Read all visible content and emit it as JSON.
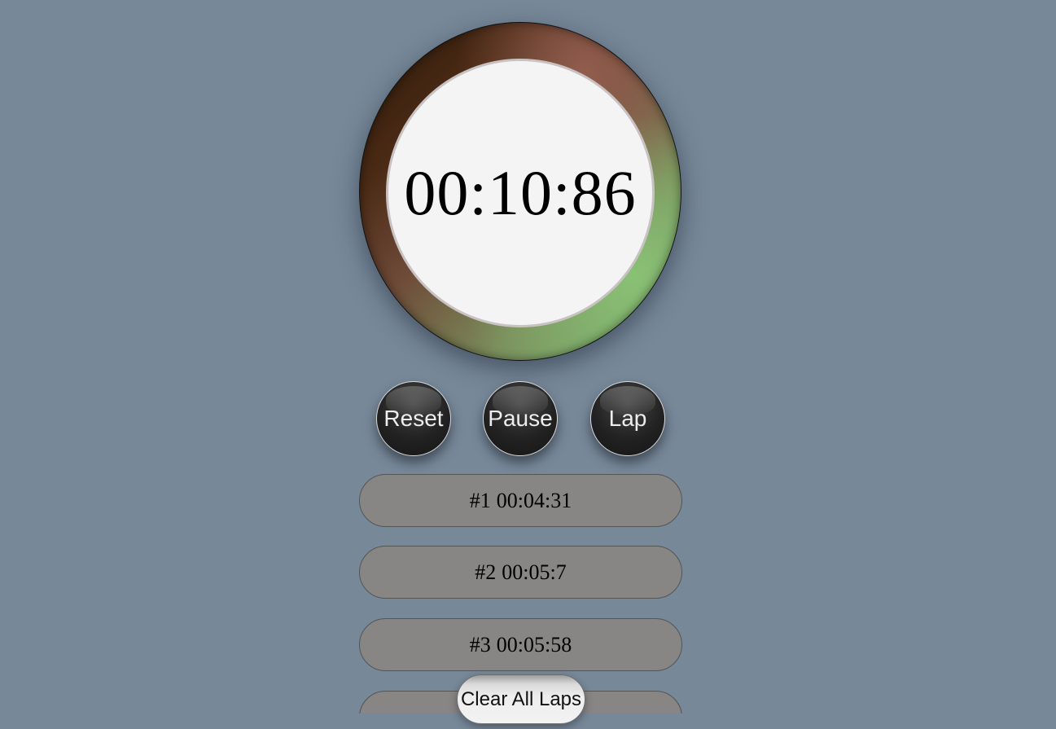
{
  "stopwatch": {
    "time_display": "00:10:86"
  },
  "controls": {
    "reset_label": "Reset",
    "pause_label": "Pause",
    "lap_label": "Lap"
  },
  "laps": [
    {
      "number": "#1",
      "time": "00:04:31"
    },
    {
      "number": "#2",
      "time": "00:05:7"
    },
    {
      "number": "#3",
      "time": "00:05:58"
    }
  ],
  "clear_button": {
    "label": "Clear All Laps"
  },
  "colors": {
    "background": "#778899",
    "dial_face": "#f4f4f5",
    "button_dark": "#222222",
    "lap_row": "#888585"
  }
}
